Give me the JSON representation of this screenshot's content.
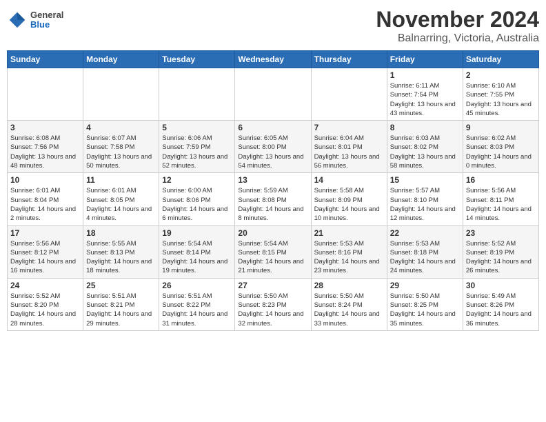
{
  "header": {
    "logo_general": "General",
    "logo_blue": "Blue",
    "title": "November 2024",
    "subtitle": "Balnarring, Victoria, Australia"
  },
  "weekdays": [
    "Sunday",
    "Monday",
    "Tuesday",
    "Wednesday",
    "Thursday",
    "Friday",
    "Saturday"
  ],
  "weeks": [
    [
      {
        "day": "",
        "info": ""
      },
      {
        "day": "",
        "info": ""
      },
      {
        "day": "",
        "info": ""
      },
      {
        "day": "",
        "info": ""
      },
      {
        "day": "",
        "info": ""
      },
      {
        "day": "1",
        "info": "Sunrise: 6:11 AM\nSunset: 7:54 PM\nDaylight: 13 hours and 43 minutes."
      },
      {
        "day": "2",
        "info": "Sunrise: 6:10 AM\nSunset: 7:55 PM\nDaylight: 13 hours and 45 minutes."
      }
    ],
    [
      {
        "day": "3",
        "info": "Sunrise: 6:08 AM\nSunset: 7:56 PM\nDaylight: 13 hours and 48 minutes."
      },
      {
        "day": "4",
        "info": "Sunrise: 6:07 AM\nSunset: 7:58 PM\nDaylight: 13 hours and 50 minutes."
      },
      {
        "day": "5",
        "info": "Sunrise: 6:06 AM\nSunset: 7:59 PM\nDaylight: 13 hours and 52 minutes."
      },
      {
        "day": "6",
        "info": "Sunrise: 6:05 AM\nSunset: 8:00 PM\nDaylight: 13 hours and 54 minutes."
      },
      {
        "day": "7",
        "info": "Sunrise: 6:04 AM\nSunset: 8:01 PM\nDaylight: 13 hours and 56 minutes."
      },
      {
        "day": "8",
        "info": "Sunrise: 6:03 AM\nSunset: 8:02 PM\nDaylight: 13 hours and 58 minutes."
      },
      {
        "day": "9",
        "info": "Sunrise: 6:02 AM\nSunset: 8:03 PM\nDaylight: 14 hours and 0 minutes."
      }
    ],
    [
      {
        "day": "10",
        "info": "Sunrise: 6:01 AM\nSunset: 8:04 PM\nDaylight: 14 hours and 2 minutes."
      },
      {
        "day": "11",
        "info": "Sunrise: 6:01 AM\nSunset: 8:05 PM\nDaylight: 14 hours and 4 minutes."
      },
      {
        "day": "12",
        "info": "Sunrise: 6:00 AM\nSunset: 8:06 PM\nDaylight: 14 hours and 6 minutes."
      },
      {
        "day": "13",
        "info": "Sunrise: 5:59 AM\nSunset: 8:08 PM\nDaylight: 14 hours and 8 minutes."
      },
      {
        "day": "14",
        "info": "Sunrise: 5:58 AM\nSunset: 8:09 PM\nDaylight: 14 hours and 10 minutes."
      },
      {
        "day": "15",
        "info": "Sunrise: 5:57 AM\nSunset: 8:10 PM\nDaylight: 14 hours and 12 minutes."
      },
      {
        "day": "16",
        "info": "Sunrise: 5:56 AM\nSunset: 8:11 PM\nDaylight: 14 hours and 14 minutes."
      }
    ],
    [
      {
        "day": "17",
        "info": "Sunrise: 5:56 AM\nSunset: 8:12 PM\nDaylight: 14 hours and 16 minutes."
      },
      {
        "day": "18",
        "info": "Sunrise: 5:55 AM\nSunset: 8:13 PM\nDaylight: 14 hours and 18 minutes."
      },
      {
        "day": "19",
        "info": "Sunrise: 5:54 AM\nSunset: 8:14 PM\nDaylight: 14 hours and 19 minutes."
      },
      {
        "day": "20",
        "info": "Sunrise: 5:54 AM\nSunset: 8:15 PM\nDaylight: 14 hours and 21 minutes."
      },
      {
        "day": "21",
        "info": "Sunrise: 5:53 AM\nSunset: 8:16 PM\nDaylight: 14 hours and 23 minutes."
      },
      {
        "day": "22",
        "info": "Sunrise: 5:53 AM\nSunset: 8:18 PM\nDaylight: 14 hours and 24 minutes."
      },
      {
        "day": "23",
        "info": "Sunrise: 5:52 AM\nSunset: 8:19 PM\nDaylight: 14 hours and 26 minutes."
      }
    ],
    [
      {
        "day": "24",
        "info": "Sunrise: 5:52 AM\nSunset: 8:20 PM\nDaylight: 14 hours and 28 minutes."
      },
      {
        "day": "25",
        "info": "Sunrise: 5:51 AM\nSunset: 8:21 PM\nDaylight: 14 hours and 29 minutes."
      },
      {
        "day": "26",
        "info": "Sunrise: 5:51 AM\nSunset: 8:22 PM\nDaylight: 14 hours and 31 minutes."
      },
      {
        "day": "27",
        "info": "Sunrise: 5:50 AM\nSunset: 8:23 PM\nDaylight: 14 hours and 32 minutes."
      },
      {
        "day": "28",
        "info": "Sunrise: 5:50 AM\nSunset: 8:24 PM\nDaylight: 14 hours and 33 minutes."
      },
      {
        "day": "29",
        "info": "Sunrise: 5:50 AM\nSunset: 8:25 PM\nDaylight: 14 hours and 35 minutes."
      },
      {
        "day": "30",
        "info": "Sunrise: 5:49 AM\nSunset: 8:26 PM\nDaylight: 14 hours and 36 minutes."
      }
    ]
  ]
}
